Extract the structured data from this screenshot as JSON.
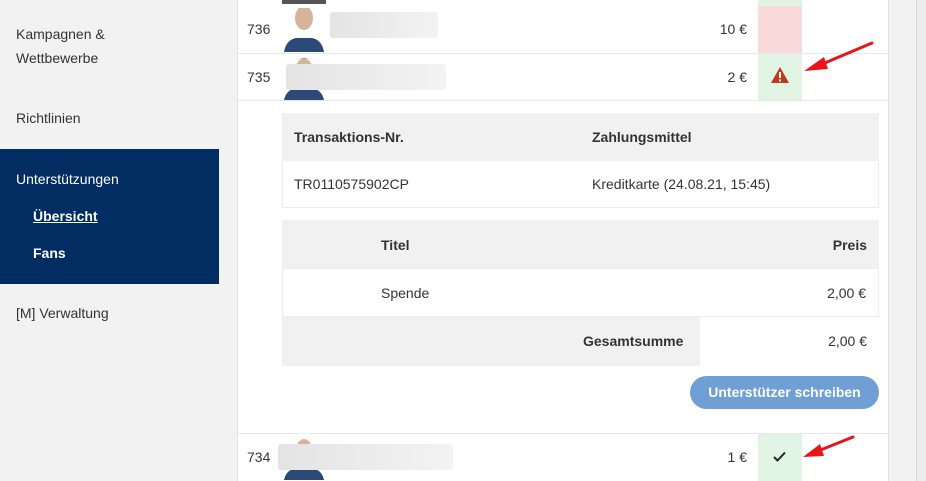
{
  "sidebar": {
    "items": [
      {
        "label": "Kampagnen &"
      },
      {
        "label": "Wettbewerbe"
      },
      {
        "label": "Richtlinien"
      },
      {
        "label": "[M] Verwaltung"
      }
    ],
    "active_section": {
      "label": "Unterstützungen",
      "subitems": [
        {
          "label": "Übersicht"
        },
        {
          "label": "Fans"
        }
      ]
    }
  },
  "rows": [
    {
      "number": "736",
      "amount": "10 €",
      "status": "pink"
    },
    {
      "number": "735",
      "amount": "2 €",
      "status": "warning"
    },
    {
      "number": "734",
      "amount": "1 €",
      "status": "check"
    }
  ],
  "transaction_table": {
    "headers": [
      "Transaktions-Nr.",
      "Zahlungsmittel"
    ],
    "values": [
      "TR0110575902CP",
      "Kreditkarte (24.08.21, 15:45)"
    ]
  },
  "items_table": {
    "headers": [
      "Titel",
      "Preis"
    ],
    "rows": [
      {
        "title": "Spende",
        "price": "2,00 €"
      }
    ],
    "total_label": "Gesamtsumme",
    "total_value": "2,00 €"
  },
  "actions": {
    "write_supporter_label": "Unterstützer schreiben"
  },
  "colors": {
    "sidebar_active": "#012d62",
    "button": "#6f9fd4",
    "warning": "#c0391b",
    "status_pink": "#f9dada",
    "status_green": "#e2f4e3",
    "annotation_arrow": "#e8141c"
  },
  "icons": {
    "warning": "warning-triangle-icon",
    "check": "checkmark-icon"
  }
}
